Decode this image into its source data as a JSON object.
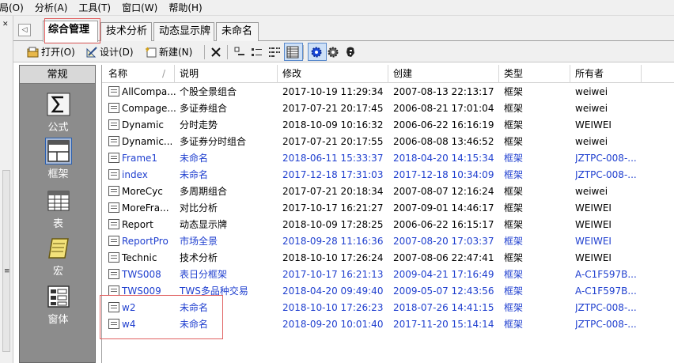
{
  "menu": [
    "局(O)",
    "分析(A)",
    "工具(T)",
    "窗口(W)",
    "帮助(H)"
  ],
  "tabs": [
    "综合管理",
    "技术分析",
    "动态显示牌",
    "未命名"
  ],
  "toolbar": {
    "open_label": "打开(O)",
    "design_label": "设计(D)",
    "new_label": "新建(N)"
  },
  "sidebar": {
    "title": "常规",
    "items": [
      "公式",
      "框架",
      "表",
      "宏",
      "窗体"
    ],
    "selected": "框架"
  },
  "columns": [
    "名称",
    "说明",
    "修改",
    "创建",
    "类型",
    "所有者"
  ],
  "rows": [
    {
      "name": "AllCompa...",
      "desc": "个股全景组合",
      "modified": "2017-10-19 11:29:34",
      "created": "2007-08-13 22:13:17",
      "type": "框架",
      "owner": "weiwei",
      "blue": false
    },
    {
      "name": "Compage...",
      "desc": "多证券组合",
      "modified": "2017-07-21 20:17:45",
      "created": "2006-08-21 17:01:04",
      "type": "框架",
      "owner": "weiwei",
      "blue": false
    },
    {
      "name": "Dynamic",
      "desc": "分时走势",
      "modified": "2018-10-09 10:16:32",
      "created": "2006-06-22 16:16:19",
      "type": "框架",
      "owner": "WEIWEI",
      "blue": false
    },
    {
      "name": "Dynamic...",
      "desc": "多证券分时组合",
      "modified": "2017-07-21 20:17:55",
      "created": "2006-08-08 13:46:52",
      "type": "框架",
      "owner": "weiwei",
      "blue": false
    },
    {
      "name": "Frame1",
      "desc": "未命名",
      "modified": "2018-06-11 15:33:37",
      "created": "2018-04-20 14:15:34",
      "type": "框架",
      "owner": "JZTPC-008-...",
      "blue": true
    },
    {
      "name": "index",
      "desc": "未命名",
      "modified": "2017-12-18 17:31:03",
      "created": "2017-12-18 10:34:09",
      "type": "框架",
      "owner": "JZTPC-008-...",
      "blue": true
    },
    {
      "name": "MoreCyc",
      "desc": "多周期组合",
      "modified": "2017-07-21 20:18:34",
      "created": "2007-08-07 12:16:24",
      "type": "框架",
      "owner": "weiwei",
      "blue": false
    },
    {
      "name": "MoreFra...",
      "desc": "对比分析",
      "modified": "2017-10-17 16:21:27",
      "created": "2007-09-01 14:46:17",
      "type": "框架",
      "owner": "WEIWEI",
      "blue": false
    },
    {
      "name": "Report",
      "desc": "动态显示牌",
      "modified": "2018-10-09 17:28:25",
      "created": "2006-06-22 16:15:17",
      "type": "框架",
      "owner": "WEIWEI",
      "blue": false
    },
    {
      "name": "ReportPro",
      "desc": "市场全景",
      "modified": "2018-09-28 11:16:36",
      "created": "2007-08-20 17:03:37",
      "type": "框架",
      "owner": "WEIWEI",
      "blue": true
    },
    {
      "name": "Technic",
      "desc": "技术分析",
      "modified": "2018-10-10 17:26:24",
      "created": "2007-08-06 22:47:41",
      "type": "框架",
      "owner": "WEIWEI",
      "blue": false
    },
    {
      "name": "TWS008",
      "desc": "表日分框架",
      "modified": "2017-10-17 16:21:13",
      "created": "2009-04-21 17:16:49",
      "type": "框架",
      "owner": "A-C1F597B...",
      "blue": true
    },
    {
      "name": "TWS009",
      "desc": "TWS多品种交易",
      "modified": "2018-04-20 09:49:40",
      "created": "2009-05-07 12:43:56",
      "type": "框架",
      "owner": "A-C1F597B...",
      "blue": true
    },
    {
      "name": "w2",
      "desc": "未命名",
      "modified": "2018-10-10 17:26:23",
      "created": "2018-07-26 14:41:15",
      "type": "框架",
      "owner": "JZTPC-008-...",
      "blue": true
    },
    {
      "name": "w4",
      "desc": "未命名",
      "modified": "2018-09-20 10:01:40",
      "created": "2017-11-20 15:14:14",
      "type": "框架",
      "owner": "JZTPC-008-...",
      "blue": true
    }
  ],
  "colors": {
    "accent_blue": "#1f3fcf",
    "highlight_red": "#e06060",
    "sidebar_bg": "#8c8c8c"
  },
  "icons": [
    "tab-nav-left-icon",
    "open-icon",
    "design-icon",
    "new-icon",
    "delete-icon",
    "large-icons-view-icon",
    "small-icons-view-icon",
    "list-view-icon",
    "details-view-icon",
    "gear-icon",
    "settings-icon",
    "help-icon",
    "formula-icon",
    "frame-icon",
    "table-icon",
    "macro-icon",
    "window-icon",
    "frame-file-icon"
  ]
}
